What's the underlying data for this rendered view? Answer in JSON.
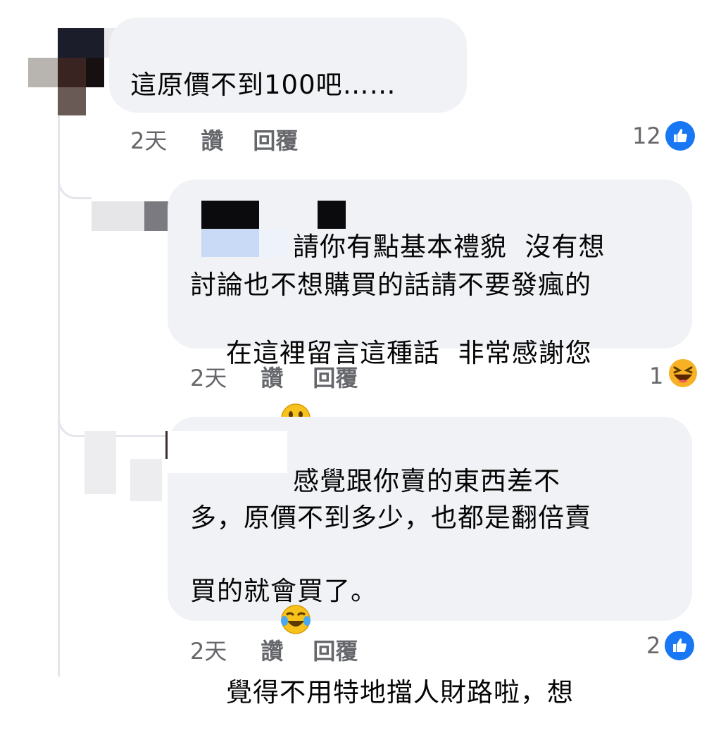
{
  "comments": [
    {
      "text": "這原價不到100吧……",
      "time": "2天",
      "like_label": "讚",
      "reply_label": "回覆",
      "reaction_count": "12",
      "reaction_type": "like-icon"
    },
    {
      "lines": [
        "請你有點基本禮貌  沒有想",
        "討論也不想購買的話請不要發瘋的",
        "在這裡留言這種話  非常感謝您"
      ],
      "inline_emoji": "smiling-face-icon",
      "time": "2天",
      "like_label": "讚",
      "reply_label": "回覆",
      "reaction_count": "1",
      "reaction_type": "haha-icon"
    },
    {
      "lines": [
        "感覺跟你賣的東西差不",
        "多，原價不到多少，也都是翻倍賣",
        "覺得不用特地擋人財路啦，想",
        "買的就會買了。"
      ],
      "inline_emoji": "tears-of-joy-icon",
      "time": "2天",
      "like_label": "讚",
      "reply_label": "回覆",
      "reaction_count": "2",
      "reaction_type": "like-icon"
    }
  ],
  "colors": {
    "bubble": "#f0f2f5",
    "meta_text": "#65676b",
    "like_blue": "#1877f2",
    "thread_line": "#e4e6eb"
  }
}
